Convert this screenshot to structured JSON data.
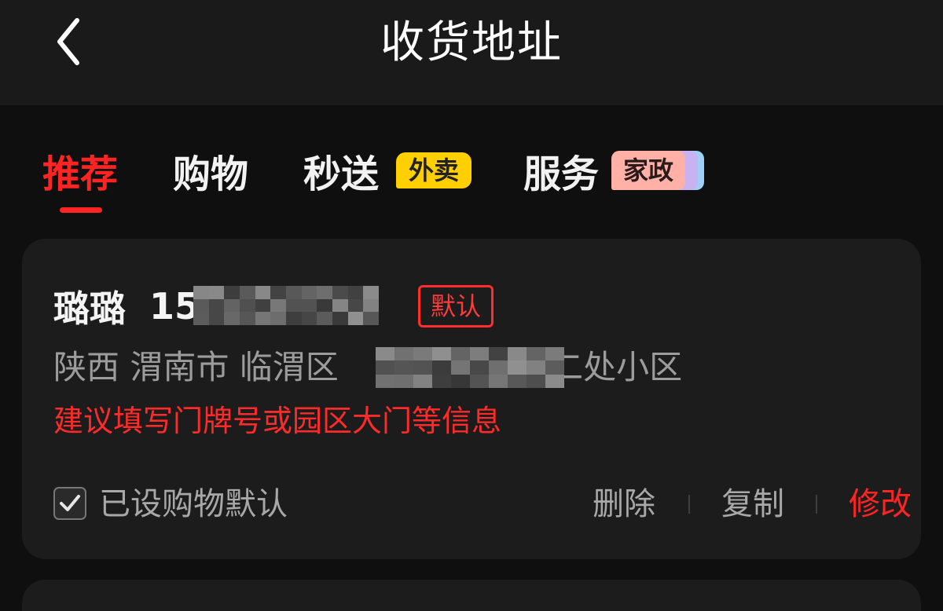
{
  "header": {
    "title": "收货地址",
    "back_icon": "chevron-left-icon"
  },
  "tabs": [
    {
      "label": "推荐",
      "active": true
    },
    {
      "label": "购物",
      "active": false
    },
    {
      "label": "秒送",
      "active": false,
      "badge": "外卖"
    },
    {
      "label": "服务",
      "active": false,
      "badge": "家政"
    }
  ],
  "address_card": {
    "name": "璐璐",
    "phone_visible": "15          86",
    "phone_redacted": true,
    "default_badge": "默认",
    "address": "陕西 渭南市 临渭区 ",
    "address_tail": "二处小区",
    "address_redacted": true,
    "hint": "建议填写门牌号或园区大门等信息",
    "shopping_default_checked": true,
    "shopping_default_label": "已设购物默认",
    "actions": {
      "delete": "删除",
      "copy": "复制",
      "edit": "修改"
    }
  },
  "colors": {
    "accent_red": "#ff2424",
    "badge_yellow": "#ffcf00",
    "badge_pink": "#ffb1a8",
    "card_bg": "#1c1c1c",
    "page_bg": "#0f0f0f"
  }
}
